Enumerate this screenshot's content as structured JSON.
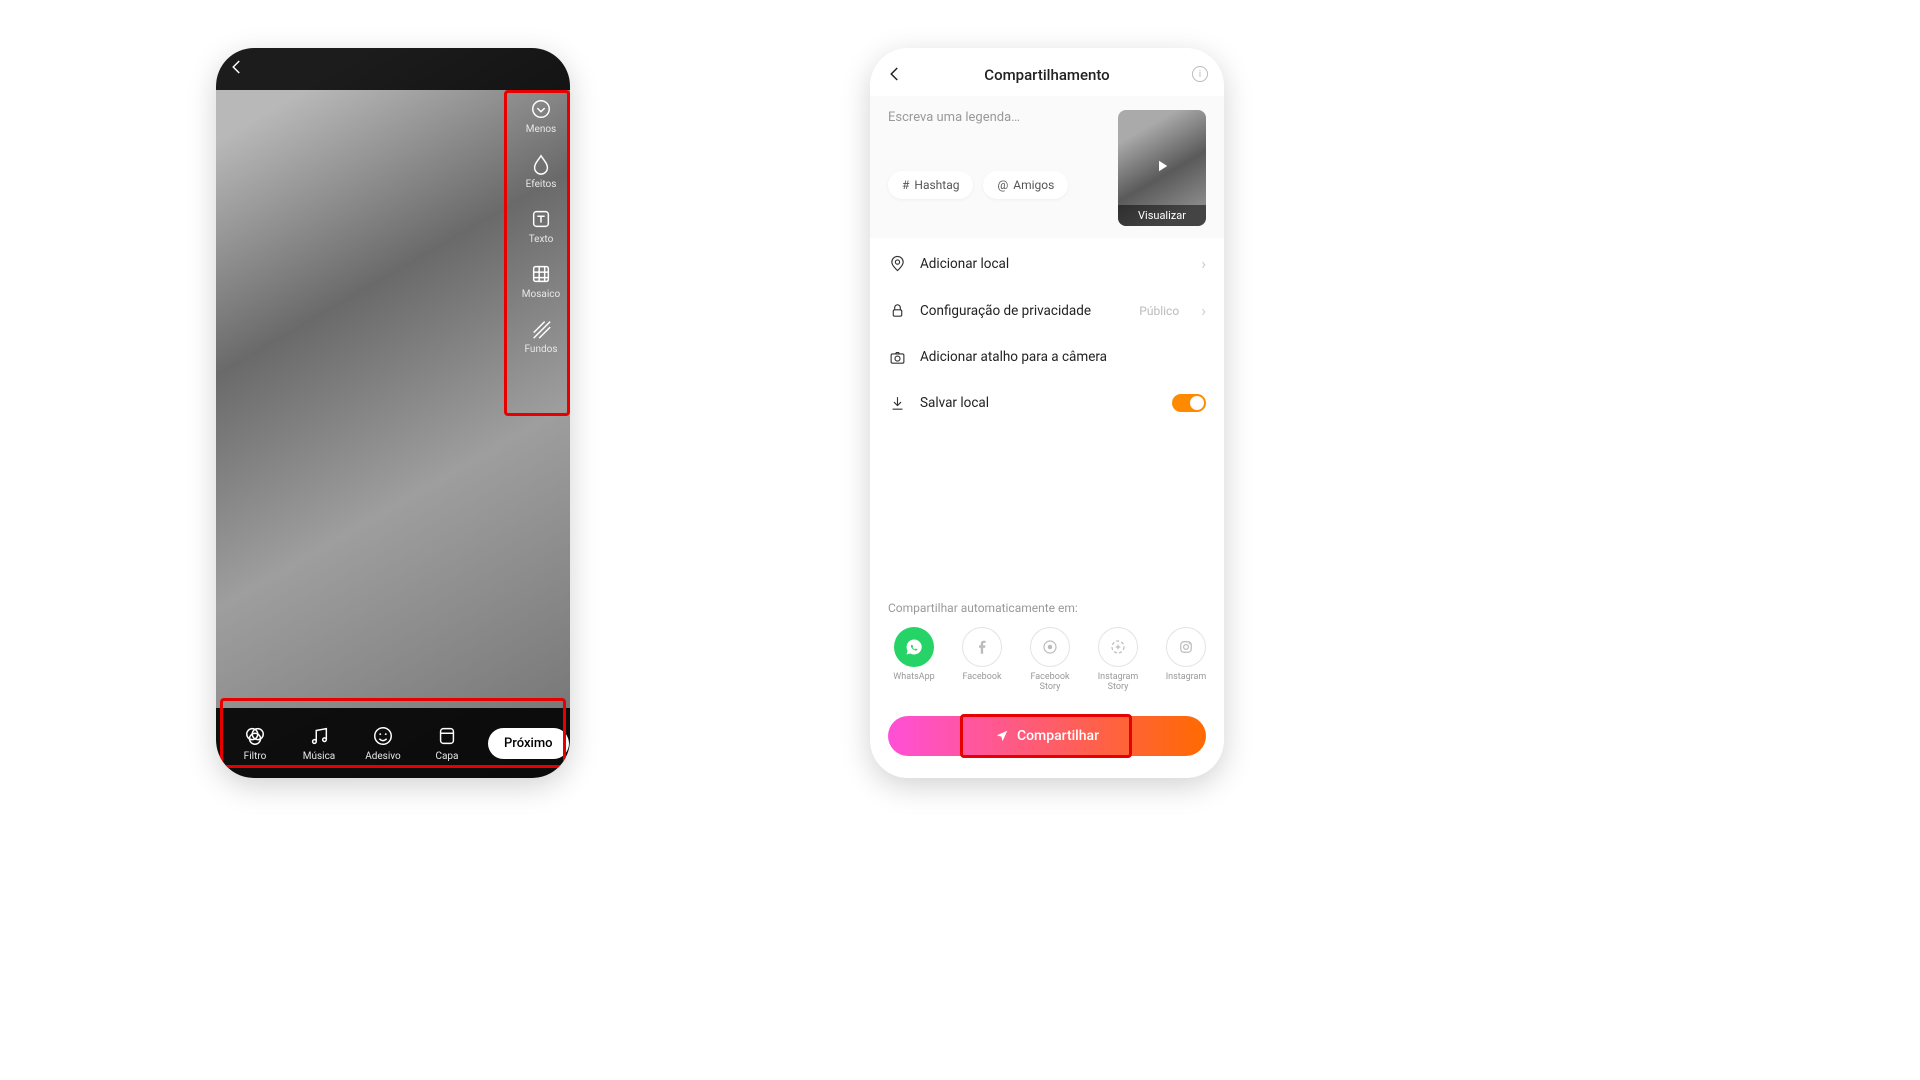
{
  "editor": {
    "side_tools": [
      {
        "key": "menos",
        "label": "Menos"
      },
      {
        "key": "efeitos",
        "label": "Efeitos"
      },
      {
        "key": "texto",
        "label": "Texto"
      },
      {
        "key": "mosaico",
        "label": "Mosaico"
      },
      {
        "key": "fundos",
        "label": "Fundos"
      }
    ],
    "bottom_tools": [
      {
        "key": "filtro",
        "label": "Filtro"
      },
      {
        "key": "musica",
        "label": "Música"
      },
      {
        "key": "adesivo",
        "label": "Adesivo"
      },
      {
        "key": "capa",
        "label": "Capa"
      }
    ],
    "next_label": "Próximo"
  },
  "share": {
    "title": "Compartilhamento",
    "caption_placeholder": "Escreva uma legenda…",
    "hashtag_chip": "Hashtag",
    "friends_chip": "Amigos",
    "thumbnail_label": "Visualizar",
    "options": {
      "location": "Adicionar local",
      "privacy_label": "Configuração de privacidade",
      "privacy_value": "Público",
      "camera_shortcut": "Adicionar atalho para a câmera",
      "save_local": "Salvar local"
    },
    "auto_share_label": "Compartilhar automaticamente em:",
    "social_apps": [
      {
        "key": "whatsapp",
        "label": "WhatsApp",
        "color": "wa"
      },
      {
        "key": "facebook",
        "label": "Facebook"
      },
      {
        "key": "facebook-story",
        "label": "Facebook Story"
      },
      {
        "key": "instagram-story",
        "label": "Instagram Story"
      },
      {
        "key": "instagram",
        "label": "Instagram"
      }
    ],
    "share_button": "Compartilhar"
  }
}
